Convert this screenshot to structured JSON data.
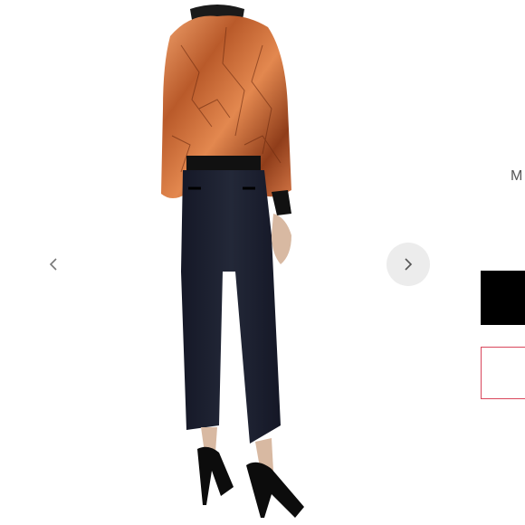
{
  "carousel": {
    "prev_icon": "chevron-left-icon",
    "next_icon": "chevron-right-icon"
  },
  "side_panel": {
    "size_initial": "M",
    "swatch_colors": [
      "#000000",
      "#ffffff"
    ],
    "selected_outline_color": "#d9475c"
  },
  "colors": {
    "jacket": "#c8743f",
    "pants": "#1d2130",
    "shoes": "#111111"
  }
}
